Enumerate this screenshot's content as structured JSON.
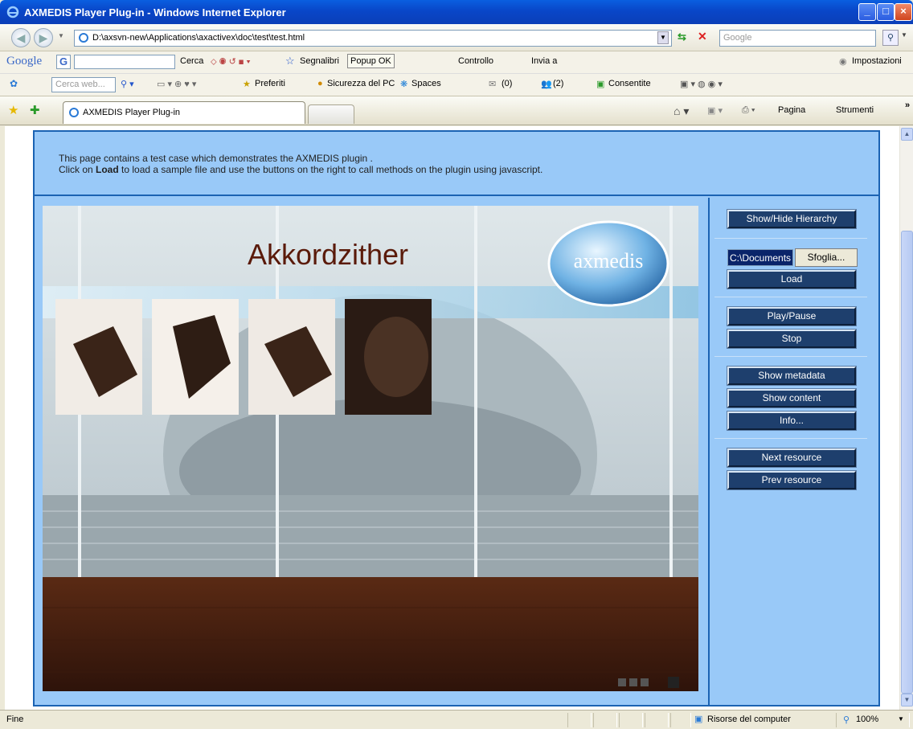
{
  "window": {
    "title": "AXMEDIS Player Plug-in - Windows Internet Explorer"
  },
  "address_bar": {
    "url": "D:\\axsvn-new\\Applications\\axactivex\\doc\\test\\test.html",
    "search_placeholder": "Google"
  },
  "google_toolbar": {
    "logo": "Google",
    "g_menu": "G",
    "search": "Cerca",
    "bookmarks": "Segnalibri",
    "popup": "Popup OK",
    "spell": "Controllo",
    "send": "Invia a",
    "settings": "Impostazioni"
  },
  "msn_toolbar": {
    "search_placeholder": "Cerca web...",
    "favorites": "Preferiti",
    "security": "Sicurezza del PC",
    "spaces": "Spaces",
    "mail_count": "(0)",
    "contacts_count": "(2)",
    "allowed": "Consentite"
  },
  "tabs": {
    "active": "AXMEDIS Player Plug-in",
    "page_menu": "Pagina",
    "tools_menu": "Strumenti"
  },
  "page": {
    "intro_line1": "This page contains a test case which demonstrates the AXMEDIS plugin .",
    "intro_line2_pre": "Click on ",
    "intro_line2_bold": "Load",
    "intro_line2_post": " to load a sample file and use the buttons on the right to call methods on the plugin using javascript.",
    "player_title": "Akkordzither",
    "logo_text": "axmedis",
    "buttons": {
      "hierarchy": "Show/Hide Hierarchy",
      "file_value": "C:\\Documents",
      "browse": "Sfoglia...",
      "load": "Load",
      "play_pause": "Play/Pause",
      "stop": "Stop",
      "show_metadata": "Show metadata",
      "show_content": "Show content",
      "info": "Info...",
      "next_resource": "Next resource",
      "prev_resource": "Prev resource"
    }
  },
  "status_bar": {
    "text": "Fine",
    "zone": "Risorse del computer",
    "zoom": "100%"
  },
  "colors": {
    "frame_bg": "#99c9f8",
    "frame_border": "#1b63b3",
    "button_bg": "#1e3f6d",
    "player_title": "#5a1a0a"
  }
}
